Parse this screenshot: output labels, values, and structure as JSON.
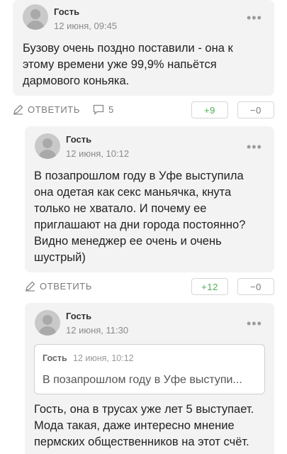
{
  "comments": [
    {
      "author": "Гость",
      "date": "12 июня, 09:45",
      "lines": [
        "Бузову очень поздно поставили - она к",
        "этому времени уже 99,9% напьётся",
        "дармового коньяка."
      ],
      "reply_label": "ОТВЕТИТЬ",
      "replies_count": "5",
      "upvotes": "+9",
      "downvotes": "−0"
    },
    {
      "author": "Гость",
      "date": "12 июня, 10:12",
      "lines": [
        "В позапрошлом году в Уфе выступила",
        "она одетая как секс маньячка, кнута",
        "только не хватало. И почему ее",
        "приглашают на дни города постоянно?",
        "Видно менеджер ее очень и очень",
        "шустрый)"
      ],
      "reply_label": "ОТВЕТИТЬ",
      "upvotes": "+12",
      "downvotes": "−0"
    },
    {
      "author": "Гость",
      "date": "12 июня, 11:30",
      "quote": {
        "author": "Гость",
        "date": "12 июня, 10:12",
        "text": "В позапрошлом году в Уфе выступи..."
      },
      "lines": [
        "Гость, она в трусах уже лет 5 выступает.",
        "Мода такая, даже интересно мнение",
        "пермских общественников на этот счёт."
      ]
    }
  ],
  "more_glyph": "•••"
}
